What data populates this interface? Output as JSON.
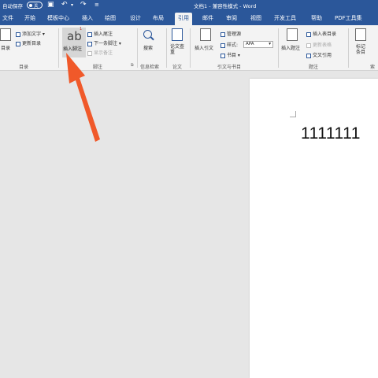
{
  "titlebar": {
    "autosave_label": "自动保存",
    "autosave_state": "关",
    "document_title": "文档1  -  兼容性模式  -  Word"
  },
  "tabs": [
    "文件",
    "开始",
    "模板中心",
    "插入",
    "绘图",
    "设计",
    "布局",
    "引用",
    "邮件",
    "审阅",
    "视图",
    "开发工具",
    "帮助",
    "PDF工具集"
  ],
  "active_tab": "引用",
  "ribbon": {
    "toc": {
      "big_label": "目录",
      "add_text": "添加文字 ▾",
      "update_toc": "更新目录",
      "group_label": "目录"
    },
    "footnotes": {
      "insert_footnote": "插入脚注",
      "insert_endnote": "插入尾注",
      "next_footnote": "下一条脚注 ▾",
      "show_notes": "显示备注",
      "group_label": "脚注"
    },
    "research": {
      "search": "搜索",
      "group_label": "信息检索"
    },
    "paper": {
      "paper_check": "论文查重",
      "group_label": "论文"
    },
    "citations": {
      "insert_citation": "插入引文",
      "manage_sources": "管理源",
      "style_label": "样式:",
      "style_value": "APA",
      "bibliography": "书目 ▾",
      "group_label": "引文与书目"
    },
    "captions": {
      "insert_caption": "插入题注",
      "insert_table_of_figures": "插入表目录",
      "update_table": "更新表格",
      "cross_reference": "交叉引用",
      "group_label": "题注"
    },
    "index": {
      "mark_entry": "标记条目",
      "group_label": "索"
    }
  },
  "document": {
    "body_text": "1111111"
  }
}
